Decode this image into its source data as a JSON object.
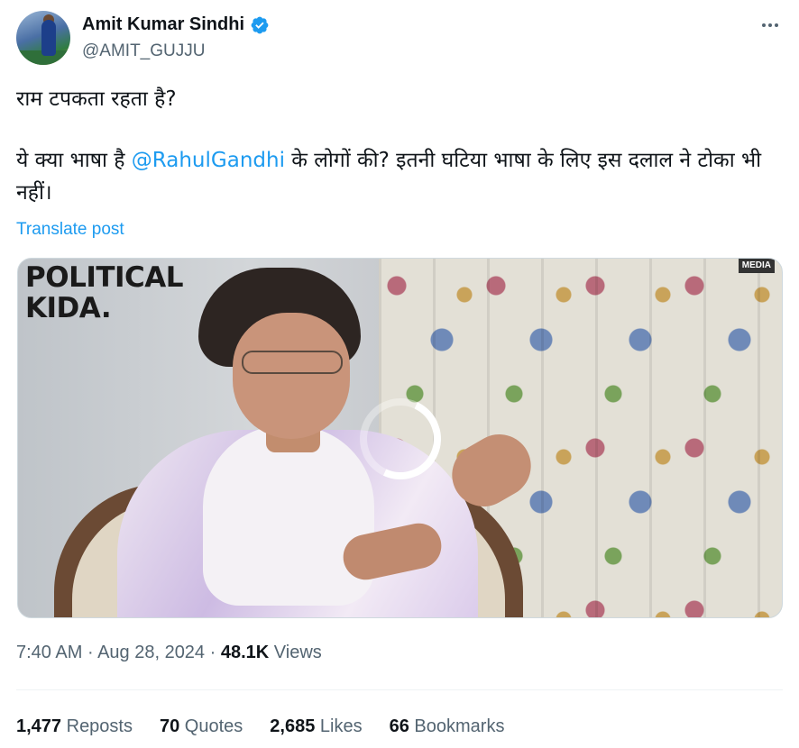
{
  "author": {
    "name": "Amit Kumar Sindhi",
    "handle": "@AMIT_GUJJU",
    "verified": true,
    "avatar_icon": "avatar-photo"
  },
  "post": {
    "line1": "राम टपकता रहता है?",
    "line2_before": "ये क्या भाषा है ",
    "mention": "@RahulGandhi",
    "line2_after": " के लोगों की? इतनी घटिया भाषा के लिए इस दलाल ने टोका भी नहीं।",
    "translate_label": "Translate post"
  },
  "media": {
    "overlay_title_line1": "POLITICAL",
    "overlay_title_line2": "KIDA.",
    "badge": "MEDIA",
    "loading_icon": "spinner-icon"
  },
  "meta": {
    "time": "7:40 AM",
    "separator": " · ",
    "date": "Aug 28, 2024",
    "views_count": "48.1K",
    "views_label": " Views"
  },
  "stats": [
    {
      "count": "1,477",
      "label": " Reposts"
    },
    {
      "count": "70",
      "label": " Quotes"
    },
    {
      "count": "2,685",
      "label": " Likes"
    },
    {
      "count": "66",
      "label": " Bookmarks"
    }
  ],
  "colors": {
    "link": "#1d9bf0",
    "secondary_text": "#536471",
    "primary_text": "#0f1419"
  }
}
